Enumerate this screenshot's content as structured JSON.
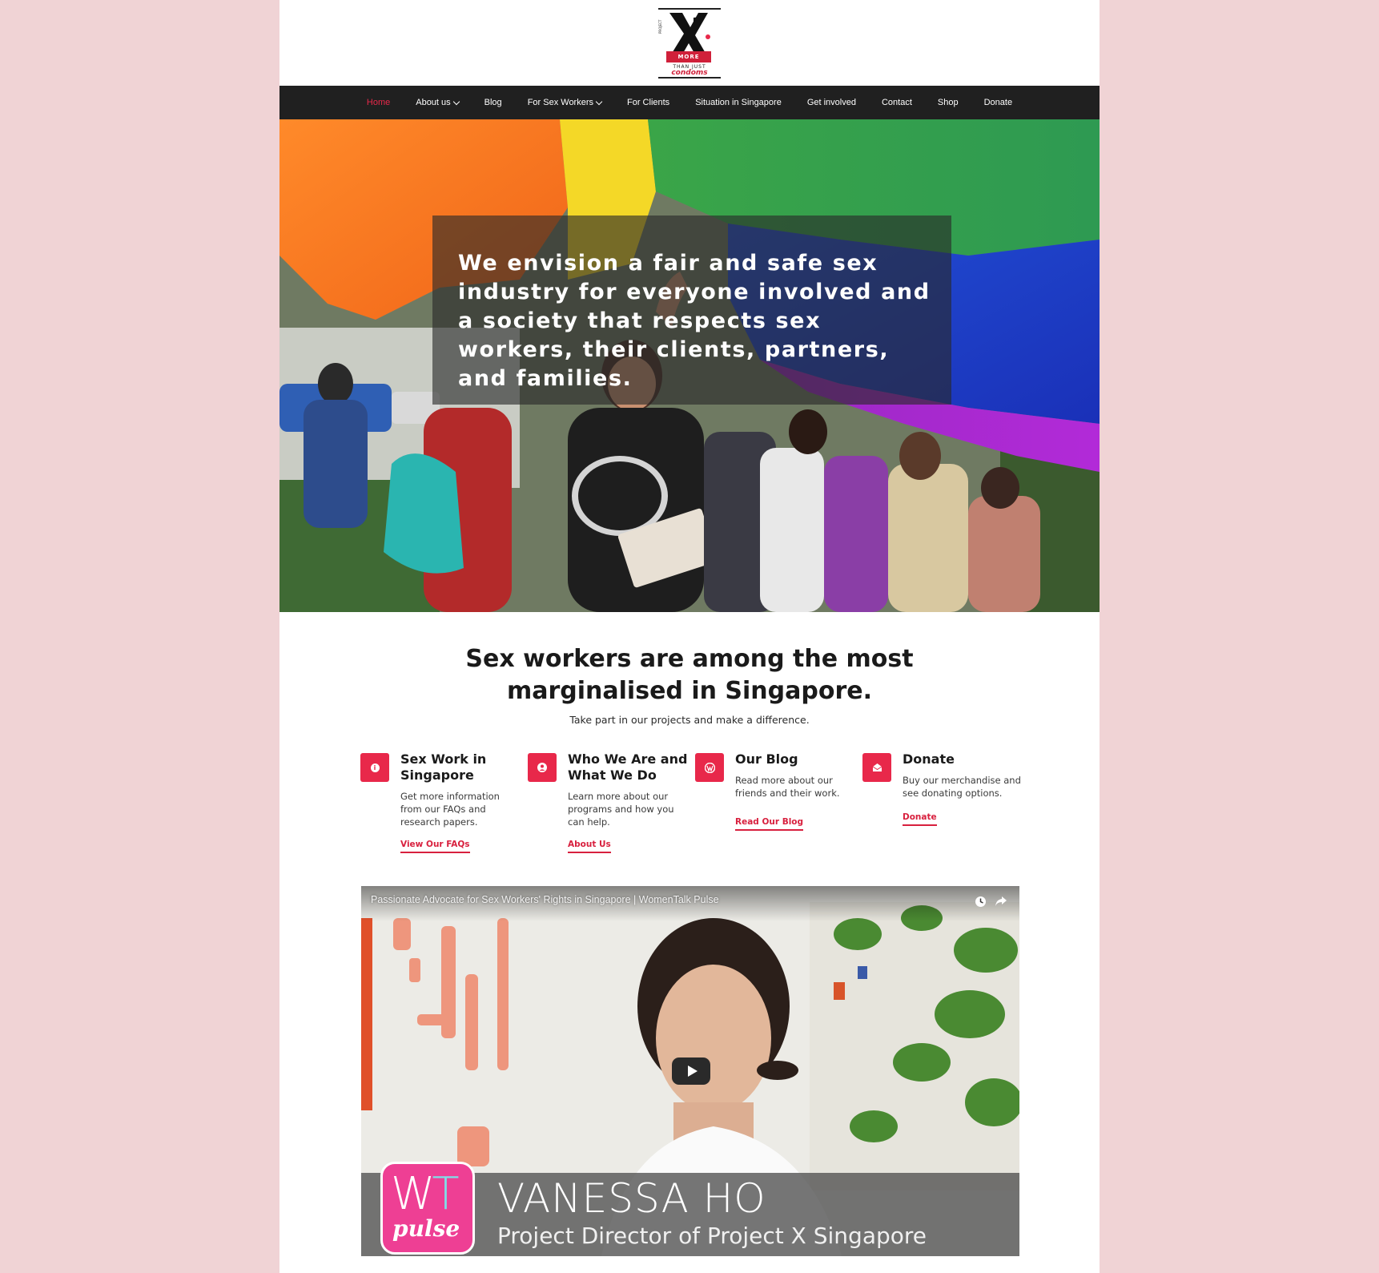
{
  "logo": {
    "project": "PROJECT",
    "more": "MORE",
    "than_just": "THAN JUST",
    "condoms": "condoms"
  },
  "nav": {
    "items": [
      {
        "label": "Home",
        "active": true,
        "dropdown": false
      },
      {
        "label": "About us",
        "active": false,
        "dropdown": true
      },
      {
        "label": "Blog",
        "active": false,
        "dropdown": false
      },
      {
        "label": "For Sex Workers",
        "active": false,
        "dropdown": true
      },
      {
        "label": "For Clients",
        "active": false,
        "dropdown": false
      },
      {
        "label": "Situation in Singapore",
        "active": false,
        "dropdown": false
      },
      {
        "label": "Get involved",
        "active": false,
        "dropdown": false
      },
      {
        "label": "Contact",
        "active": false,
        "dropdown": false
      },
      {
        "label": "Shop",
        "active": false,
        "dropdown": false
      },
      {
        "label": "Donate",
        "active": false,
        "dropdown": false
      }
    ]
  },
  "hero": {
    "text": "We envision a fair and safe sex industry for everyone involved and a society that respects sex workers, their clients, partners, and families."
  },
  "intro": {
    "title_line1": "Sex workers are among the most",
    "title_line2": "marginalised in Singapore.",
    "subtitle": "Take part in our projects and make a difference."
  },
  "features": [
    {
      "icon": "info-icon",
      "title": "Sex Work in Singapore",
      "description": "Get more information from our FAQs and research papers.",
      "link": "View Our FAQs"
    },
    {
      "icon": "user-icon",
      "title": "Who We Are and What We Do",
      "description": "Learn more about our programs and how you can help.",
      "link": "About Us"
    },
    {
      "icon": "wordpress-icon",
      "title": "Our Blog",
      "description": "Read more about our friends and their work.",
      "link": "Read Our Blog"
    },
    {
      "icon": "envelope-icon",
      "title": "Donate",
      "description": "Buy our merchandise and see donating options.",
      "link": "Donate"
    }
  ],
  "video": {
    "title": "Passionate Advocate for Sex Workers' Rights in Singapore | WomenTalk Pulse",
    "logo_wt_w": "W",
    "logo_wt_t": "T",
    "logo_pulse": "pulse",
    "name": "VANESSA HO",
    "role": "Project Director of Project X Singapore"
  },
  "colors": {
    "accent": "#e8284a",
    "nav_bg": "#202020",
    "page_bg": "#f0d3d5"
  }
}
